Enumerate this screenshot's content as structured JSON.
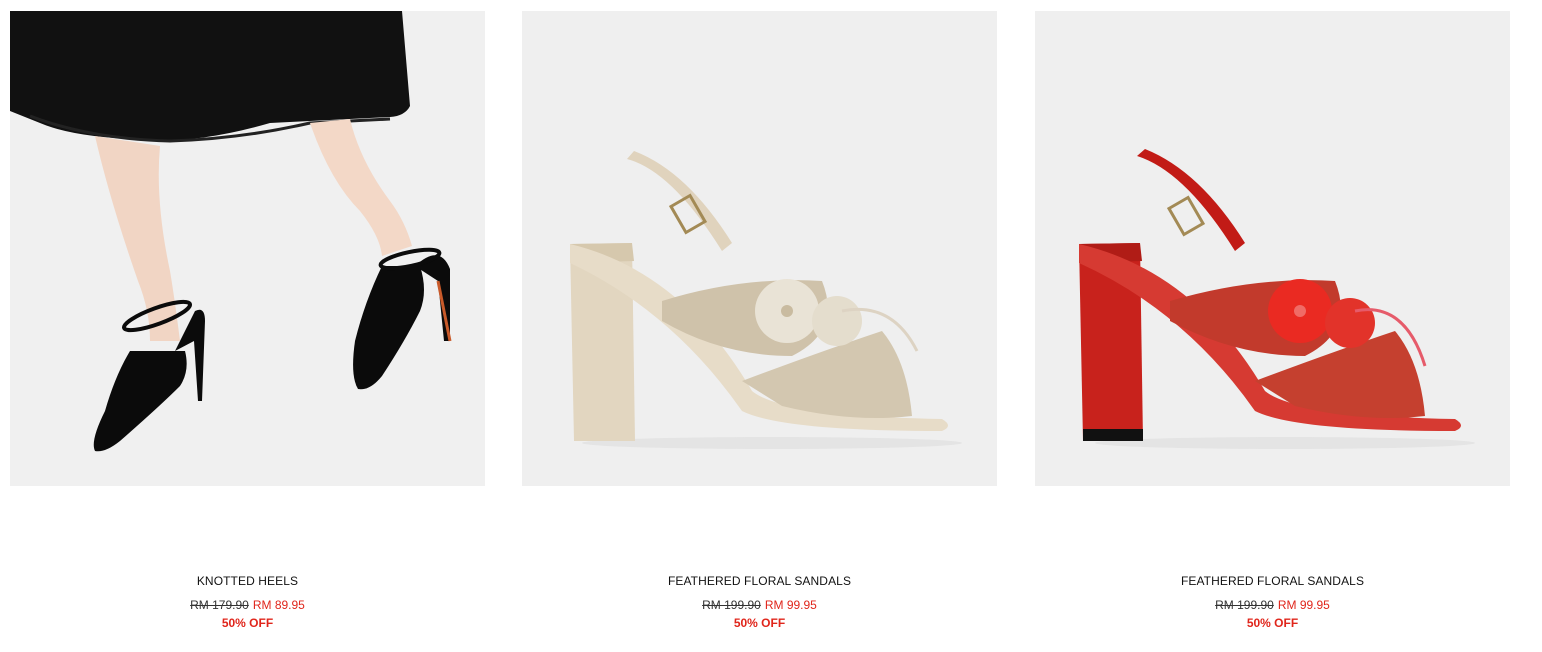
{
  "products": [
    {
      "name": "KNOTTED HEELS",
      "old_price": "RM 179.90",
      "new_price": "RM 89.95",
      "discount": "50% OFF",
      "image_icon": "black-knotted-heels-photo"
    },
    {
      "name": "FEATHERED FLORAL SANDALS",
      "old_price": "RM 199.90",
      "new_price": "RM 99.95",
      "discount": "50% OFF",
      "image_icon": "beige-feathered-sandal-photo"
    },
    {
      "name": "FEATHERED FLORAL SANDALS",
      "old_price": "RM 199.90",
      "new_price": "RM 99.95",
      "discount": "50% OFF",
      "image_icon": "red-feathered-sandal-photo"
    }
  ],
  "colors": {
    "sale_red": "#e0251b",
    "image_bg": "#efefef",
    "beige_heel": "#e2d6c0",
    "red_heel": "#c8221c"
  }
}
